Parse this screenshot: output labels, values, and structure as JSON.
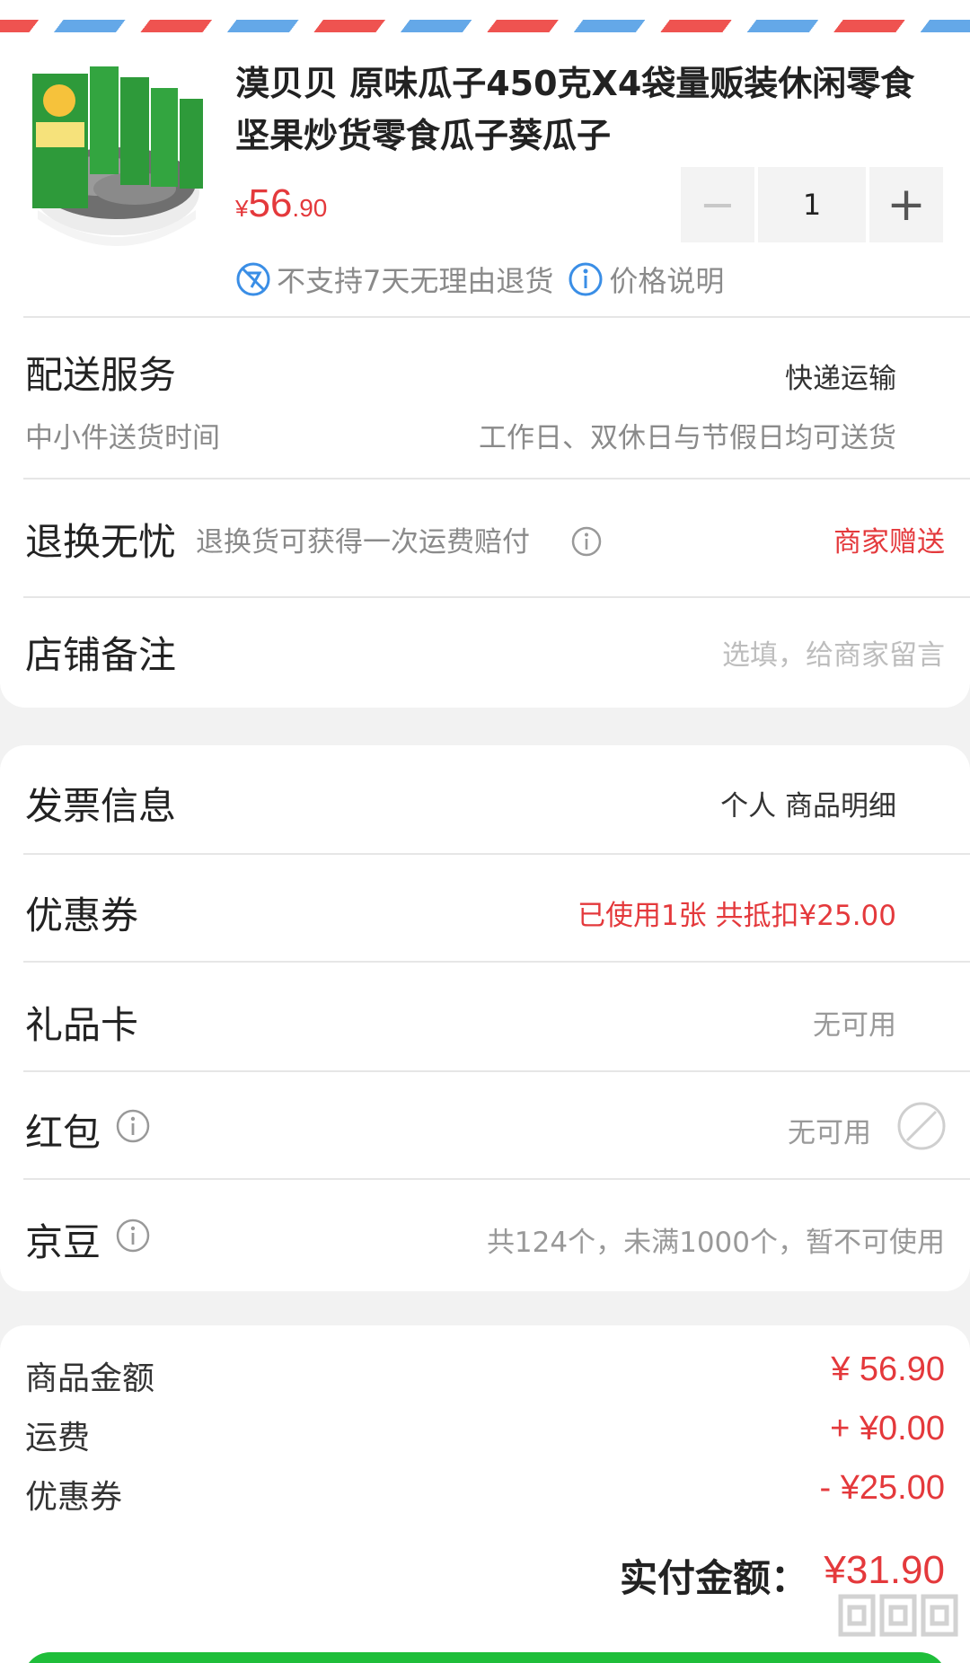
{
  "product": {
    "title": "漠贝贝 原味瓜子450克X4袋量贩装休闲零食坚果炒货零食瓜子葵瓜子",
    "price_currency": "¥",
    "price_int": "56",
    "price_dec": ".90",
    "quantity": "1",
    "minus": "−",
    "plus": "+",
    "no_return": "不支持7天无理由退货",
    "price_note": "价格说明"
  },
  "delivery": {
    "title": "配送服务",
    "method": "快递运输",
    "sub_label": "中小件送货时间",
    "sub_value": "工作日、双休日与节假日均可送货"
  },
  "exchange": {
    "title": "退换无忧",
    "desc": "退换货可获得一次运费赔付",
    "value": "商家赠送"
  },
  "store_note": {
    "title": "店铺备注",
    "placeholder": "选填，给商家留言"
  },
  "invoice": {
    "title": "发票信息",
    "value": "个人 商品明细"
  },
  "coupon": {
    "title": "优惠券",
    "value": "已使用1张 共抵扣¥25.00"
  },
  "gift_card": {
    "title": "礼品卡",
    "value": "无可用"
  },
  "red_packet": {
    "title": "红包",
    "value": "无可用"
  },
  "jingdou": {
    "title": "京豆",
    "value": "共124个，未满1000个，暂不可使用"
  },
  "summary": {
    "goods_label": "商品金额",
    "goods_value": "¥ 56.90",
    "freight_label": "运费",
    "freight_value": "+ ¥0.00",
    "coupon_label": "优惠券",
    "coupon_value": "- ¥25.00"
  },
  "payment": {
    "label": "实付金额：",
    "value": "¥31.90"
  },
  "colors": {
    "accent_red": "#e4393c",
    "info_blue": "#3a8ee6",
    "submit_green": "#1fbe3a"
  }
}
